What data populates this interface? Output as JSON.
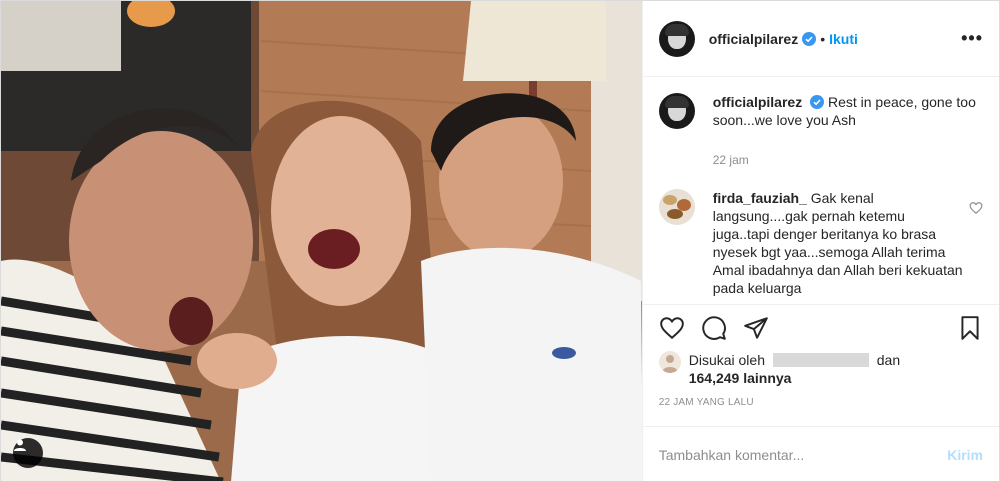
{
  "post": {
    "photo_alt": "",
    "tag_icon": "user-tag-icon"
  },
  "header": {
    "username": "officialpilarez",
    "separator": "•",
    "follow_label": "Ikuti",
    "more_label": "•••"
  },
  "caption": {
    "username": "officialpilarez",
    "text": "Rest in peace, gone too soon...we love you Ash",
    "time": "22 jam"
  },
  "comments": [
    {
      "username": "firda_fauziah_",
      "text": "Gak kenal langsung....gak pernah ketemu juga..tapi denger beritanya ko brasa nyesek bgt yaa...semoga Allah terima Amal ibadahnya dan Allah beri kekuatan pada keluarga"
    }
  ],
  "likes": {
    "prefix": "Disukai oleh",
    "joiner": "dan",
    "count": "164,249 lainnya"
  },
  "time_ago": "22 JAM YANG LALU",
  "add_comment": {
    "placeholder": "Tambahkan komentar...",
    "post_label": "Kirim"
  },
  "colors": {
    "accent": "#0095f6",
    "post_disabled": "#b2dffc",
    "muted": "#8e8e8e"
  }
}
